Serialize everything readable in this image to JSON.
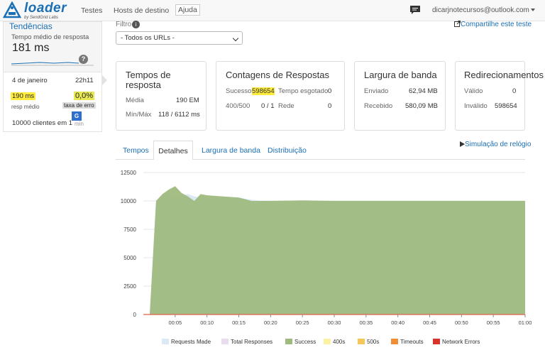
{
  "header": {
    "logo_text": "loader",
    "logo_sub": "by SendGrid Labs",
    "nav": [
      "Testes",
      "Hosts de destino",
      "Ajuda"
    ],
    "user": "dicarjnotecursos@outlook.com"
  },
  "sidebar": {
    "title": "Tendências",
    "subtitle": "Tempo médio de resposta",
    "big_value": "181 ms",
    "help": "?",
    "date": "4 de janeiro",
    "time": "22h11",
    "resp_ms": "190 ms",
    "error_pct": "0,0%",
    "resp_label": "resp médio",
    "error_label": "taxa de erro",
    "clients": "10000 clientes em 1",
    "min": "min"
  },
  "filter": {
    "label": "Filtro",
    "info": "i",
    "selected": "- Todos os URLs -"
  },
  "share": "Compartilhe este teste",
  "cards": {
    "times": {
      "title": "Tempos de resposta",
      "avg_label": "Média",
      "avg_value": "190 EM",
      "minmax_label": "Mín/Máx",
      "minmax_value": "118 / 6112 ms"
    },
    "counts": {
      "title": "Contagens de Respostas",
      "success_label": "Sucesso",
      "success_value": "598654",
      "timeout_label": "Tempo esgotado",
      "timeout_value": "0",
      "err_label": "400/500",
      "err_value": "0 / 1",
      "net_label": "Rede",
      "net_value": "0"
    },
    "bandwidth": {
      "title": "Largura de banda",
      "sent_label": "Enviado",
      "sent_value": "62,94 MB",
      "recv_label": "Recebido",
      "recv_value": "580,09 MB"
    },
    "redirects": {
      "title": "Redirecionamentos",
      "valid_label": "Válido",
      "valid_value": "0",
      "invalid_label": "Inválido",
      "invalid_value": "598654"
    }
  },
  "tabs": [
    "Tempos",
    "Detalhes",
    "Largura de banda",
    "Distribuição"
  ],
  "simulation": "Simulação de relógio",
  "chart_data": {
    "type": "area",
    "x": [
      "00:00",
      "00:01",
      "00:02",
      "00:03",
      "00:04",
      "00:05",
      "00:06",
      "00:07",
      "00:08",
      "00:09",
      "00:10",
      "00:11",
      "00:15",
      "00:17",
      "00:18",
      "00:20",
      "00:25",
      "00:30",
      "00:35",
      "00:40",
      "00:45",
      "00:50",
      "00:55",
      "01:00"
    ],
    "x_ticks": [
      "00:05",
      "00:10",
      "00:15",
      "00:20",
      "00:25",
      "00:30",
      "00:35",
      "00:40",
      "00:45",
      "00:50",
      "00:55",
      "01:00"
    ],
    "y_ticks": [
      "12500",
      "10000",
      "7500",
      "5000",
      "2500",
      "0"
    ],
    "ylim": [
      0,
      12500
    ],
    "series": [
      {
        "name": "Requests Made",
        "color": "#dce9f5",
        "values": [
          0,
          0,
          10000,
          10500,
          10700,
          10300,
          10500,
          10600,
          10400,
          10300,
          10500,
          10400,
          10300,
          10100,
          10050,
          10000,
          10050,
          10000,
          10000,
          10000,
          10000,
          10000,
          10000,
          10000
        ]
      },
      {
        "name": "Total Responses",
        "color": "#eadcf0",
        "values": [
          0,
          0,
          0,
          0,
          0,
          0,
          0,
          0,
          0,
          0,
          0,
          0,
          0,
          0,
          0,
          0,
          0,
          0,
          0,
          0,
          0,
          0,
          0,
          0
        ]
      },
      {
        "name": "Success",
        "color": "#9fba7f",
        "values": [
          0,
          0,
          10000,
          10600,
          11000,
          11300,
          10700,
          10400,
          10000,
          10600,
          10500,
          10450,
          10300,
          10000,
          10000,
          10000,
          10050,
          10000,
          10000,
          10000,
          10000,
          10000,
          10000,
          10000
        ]
      },
      {
        "name": "400s",
        "color": "#fbf2a3",
        "values": [
          0,
          0,
          0,
          0,
          0,
          0,
          0,
          0,
          0,
          0,
          0,
          0,
          0,
          0,
          0,
          0,
          0,
          0,
          0,
          0,
          0,
          0,
          0,
          0
        ]
      },
      {
        "name": "500s",
        "color": "#f5c65a",
        "values": [
          0,
          0,
          0,
          0,
          0,
          0,
          0,
          0,
          0,
          0,
          0,
          0,
          0,
          0,
          0,
          0,
          0,
          0,
          0,
          0,
          0,
          0,
          0,
          0
        ]
      },
      {
        "name": "Timeouts",
        "color": "#f28c35",
        "values": [
          0,
          0,
          0,
          0,
          0,
          0,
          0,
          0,
          0,
          0,
          0,
          0,
          0,
          0,
          0,
          0,
          0,
          0,
          0,
          0,
          0,
          0,
          0,
          0
        ]
      },
      {
        "name": "Network Errors",
        "color": "#d9342b",
        "values": [
          0,
          0,
          0,
          0,
          0,
          0,
          0,
          0,
          0,
          0,
          0,
          0,
          0,
          0,
          0,
          0,
          0,
          0,
          0,
          0,
          0,
          0,
          0,
          0
        ]
      }
    ],
    "legend": "bottom",
    "grid": true
  }
}
